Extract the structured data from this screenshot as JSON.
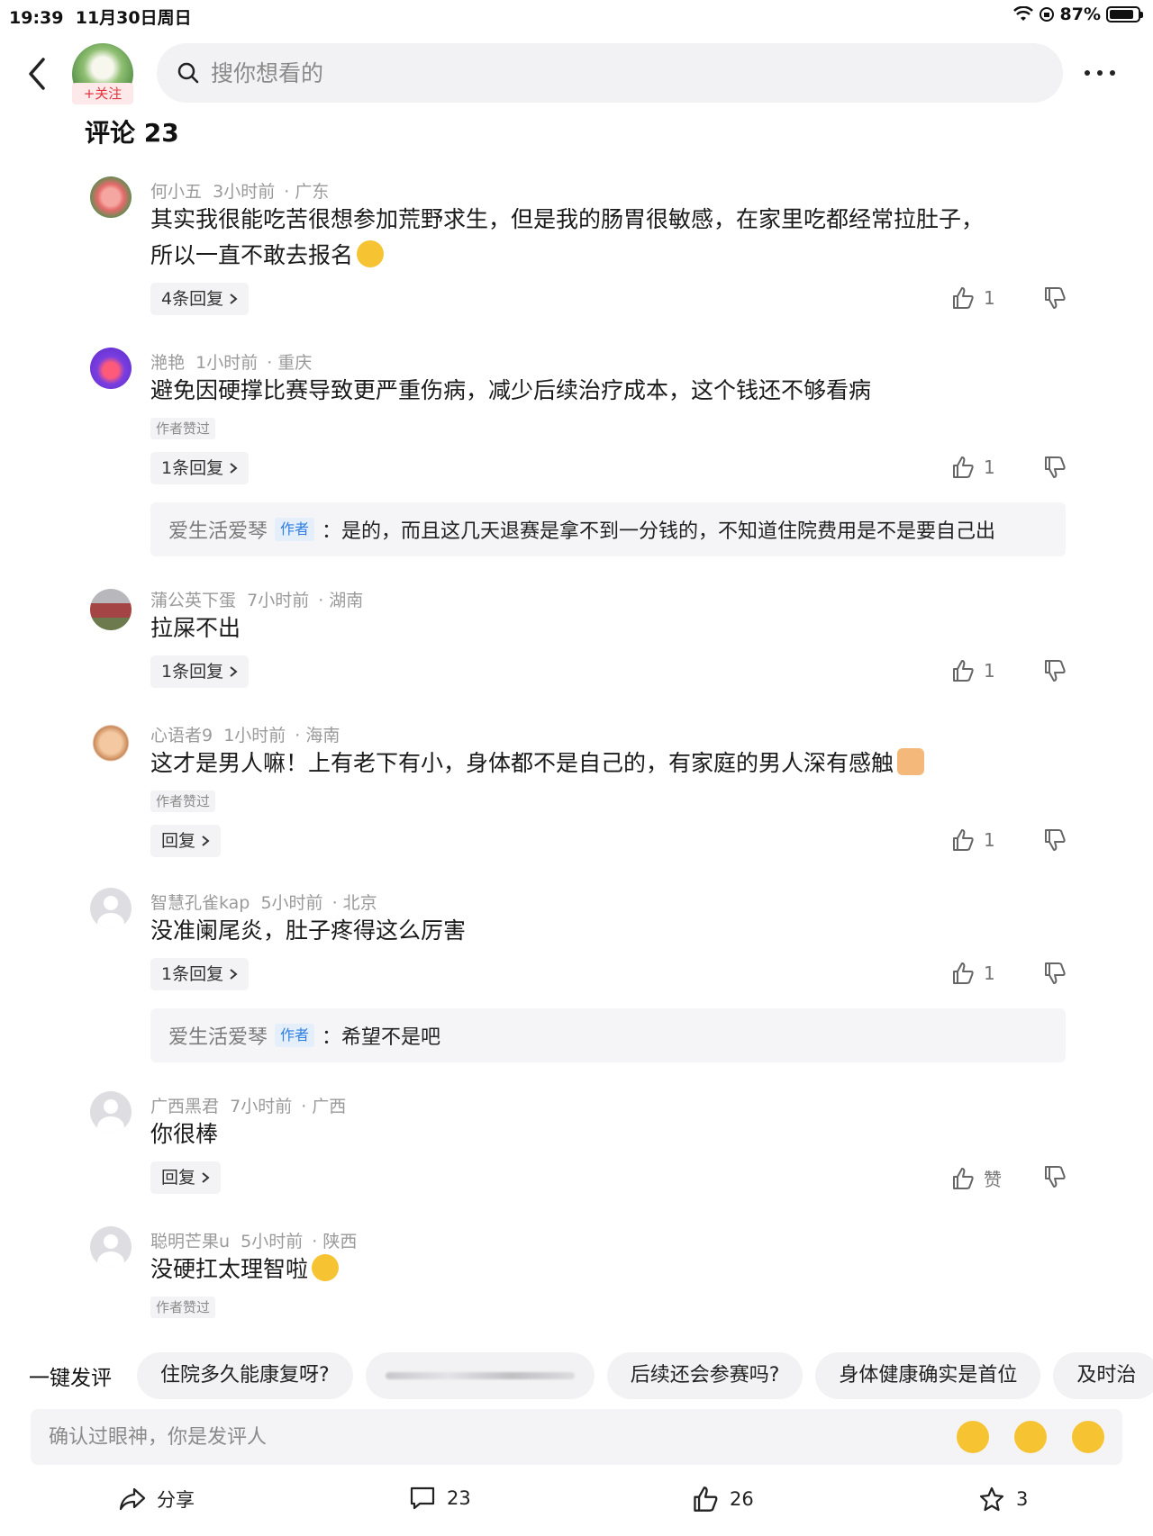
{
  "status_bar": {
    "time": "19:39",
    "date": "11月30日周日",
    "battery": "87%",
    "battery_level": 0.87
  },
  "header": {
    "follow_label": "+关注",
    "search_placeholder": "搜你想看的"
  },
  "comments_title": "评论 23",
  "comments": [
    {
      "user": "何小五",
      "time": "3小时前",
      "loc": "广东",
      "text": "其实我很能吃苦很想参加荒野求生，但是我的肠胃很敏感，在家里吃都经常拉肚子，",
      "text2": "所以一直不敢去报名",
      "reply": "4条回复",
      "likes": "1",
      "author_liked": "",
      "sub_reply_user": "",
      "sub_reply_tag": "",
      "sub_reply_text": ""
    },
    {
      "user": "滟艳",
      "time": "1小时前",
      "loc": "重庆",
      "text": "避免因硬撑比赛导致更严重伤病，减少后续治疗成本，这个钱还不够看病",
      "text2": "",
      "reply": "1条回复",
      "likes": "1",
      "author_liked": "作者赞过",
      "sub_reply_user": "爱生活爱琴",
      "sub_reply_tag": "作者",
      "sub_reply_text": "：是的，而且这几天退赛是拿不到一分钱的，不知道住院费用是不是要自己出"
    },
    {
      "user": "蒲公英下蛋",
      "time": "7小时前",
      "loc": "湖南",
      "text": "拉屎不出",
      "text2": "",
      "reply": "1条回复",
      "likes": "1",
      "author_liked": "",
      "sub_reply_user": "",
      "sub_reply_tag": "",
      "sub_reply_text": ""
    },
    {
      "user": "心语者9",
      "time": "1小时前",
      "loc": "海南",
      "text": "这才是男人嘛！上有老下有小，身体都不是自己的，有家庭的男人深有感触",
      "text2": "",
      "reply": "回复",
      "likes": "1",
      "author_liked": "作者赞过",
      "sub_reply_user": "",
      "sub_reply_tag": "",
      "sub_reply_text": ""
    },
    {
      "user": "智慧孔雀kap",
      "time": "5小时前",
      "loc": "北京",
      "text": "没准阑尾炎，肚子疼得这么厉害",
      "text2": "",
      "reply": "1条回复",
      "likes": "1",
      "author_liked": "",
      "sub_reply_user": "爱生活爱琴",
      "sub_reply_tag": "作者",
      "sub_reply_text": "：希望不是吧"
    },
    {
      "user": "广西黑君",
      "time": "7小时前",
      "loc": "广西",
      "text": "你很棒",
      "text2": "",
      "reply": "回复",
      "likes": "赞",
      "author_liked": "",
      "sub_reply_user": "",
      "sub_reply_tag": "",
      "sub_reply_text": ""
    },
    {
      "user": "聪明芒果u",
      "time": "5小时前",
      "loc": "陕西",
      "text": "没硬扛太理智啦",
      "text2": "",
      "reply": "",
      "likes": "",
      "author_liked": "作者赞过",
      "sub_reply_user": "",
      "sub_reply_tag": "",
      "sub_reply_text": ""
    }
  ],
  "quick_comments": {
    "label": "一键发评",
    "chips": [
      "住院多久能康复呀?",
      "",
      "后续还会参赛吗?",
      "身体健康确实是首位",
      "及时治"
    ]
  },
  "compose": {
    "placeholder": "确认过眼神，你是发评人"
  },
  "bottom_bar": {
    "share": "分享",
    "comments": "23",
    "likes": "26",
    "favorites": "3"
  },
  "colors": {
    "accent_red": "#e2343c",
    "author_blue": "#2f7fe0",
    "gray_text": "#9a9a9a",
    "chip_bg": "#f2f2f4"
  },
  "icons": [
    "back-icon",
    "search-icon",
    "more-icon",
    "thumb-up-icon",
    "thumb-down-icon",
    "chevron-right-icon",
    "share-icon",
    "comment-icon",
    "star-icon",
    "wifi-icon",
    "battery-icon"
  ]
}
